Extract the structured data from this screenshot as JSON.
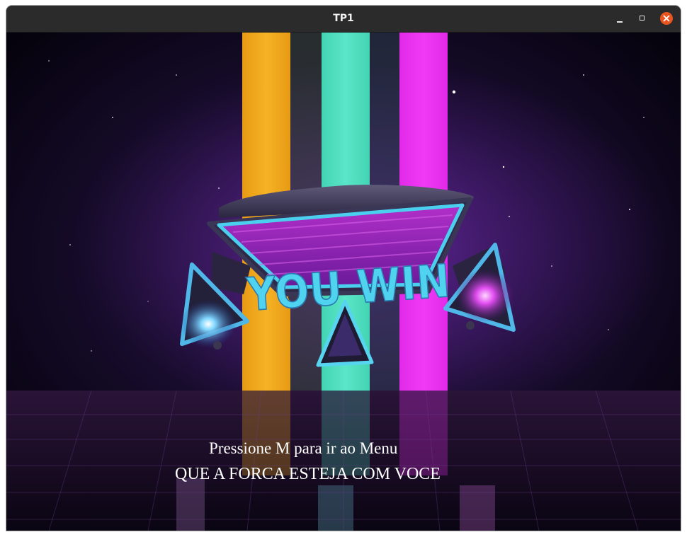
{
  "window": {
    "title": "TP1",
    "controls": {
      "minimize": "minimize-icon",
      "maximize": "maximize-icon",
      "close": "close-icon"
    }
  },
  "scene": {
    "banner_text": "YOU WIN",
    "beam_colors": [
      "#f4ac1c",
      "#4fe0bf",
      "#ea2df0"
    ],
    "accent_cyan": "#46d8f0",
    "accent_purple": "#8a1fb0"
  },
  "messages": {
    "menu_prompt": "Pressione M para ir ao Menu",
    "tagline": "QUE A FORCA ESTEJA COM VOCE"
  }
}
